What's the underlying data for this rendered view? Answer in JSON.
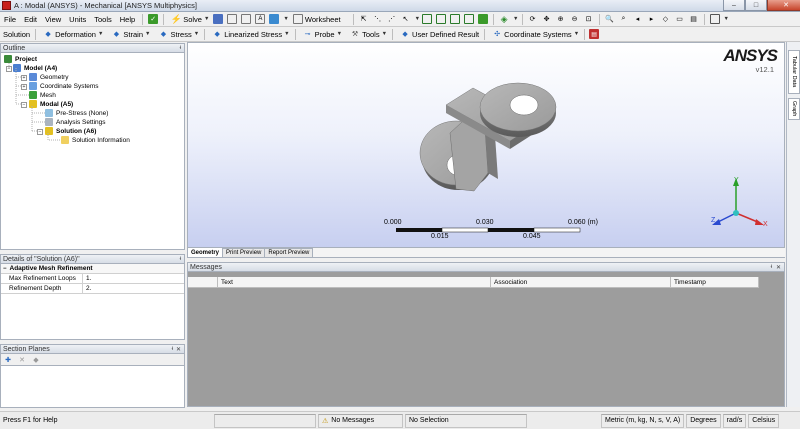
{
  "window": {
    "title": "A : Modal (ANSYS) - Mechanical [ANSYS Multiphysics]",
    "minimize": "–",
    "maximize": "□",
    "close": "✕"
  },
  "menu": {
    "items": [
      "File",
      "Edit",
      "View",
      "Units",
      "Tools",
      "Help"
    ],
    "solve_label": "Solve",
    "worksheet_label": "Worksheet"
  },
  "context_toolbar": {
    "items": [
      "Solution",
      "Deformation",
      "Strain",
      "Stress",
      "Linearized Stress",
      "Probe",
      "Tools",
      "User Defined Result",
      "Coordinate Systems"
    ]
  },
  "outline": {
    "title": "Outline",
    "pin": "ᵻ",
    "nodes": [
      "Project",
      "Model (A4)",
      "Geometry",
      "Coordinate Systems",
      "Mesh",
      "Modal (A5)",
      "Pre-Stress (None)",
      "Analysis Settings",
      "Solution (A6)",
      "Solution Information"
    ]
  },
  "details": {
    "title": "Details of \"Solution (A6)\"",
    "group": "Adaptive Mesh Refinement",
    "rows": [
      {
        "label": "Max Refinement Loops",
        "value": "1."
      },
      {
        "label": "Refinement Depth",
        "value": "2."
      }
    ]
  },
  "section_planes": {
    "title": "Section Planes"
  },
  "viewport": {
    "brand": "ANSYS",
    "version": "v12.1",
    "scale": {
      "top": [
        "0.000",
        "0.030",
        "0.060 (m)"
      ],
      "bottom": [
        "0.015",
        "0.045"
      ]
    },
    "axes": {
      "x": "X",
      "y": "Y",
      "z": "Z"
    }
  },
  "side_tabs": [
    "Tabular Data",
    "Graph"
  ],
  "view_tabs": [
    "Geometry",
    "Print Preview",
    "Report Preview"
  ],
  "messages": {
    "title": "Messages",
    "columns": [
      "Text",
      "Association",
      "Timestamp"
    ]
  },
  "status": {
    "help": "Press F1 for Help",
    "messages": "No Messages",
    "selection": "No Selection",
    "units": "Metric (m, kg, N, s, V, A)",
    "angle": "Degrees",
    "rate": "rad/s",
    "temp": "Celsius"
  }
}
